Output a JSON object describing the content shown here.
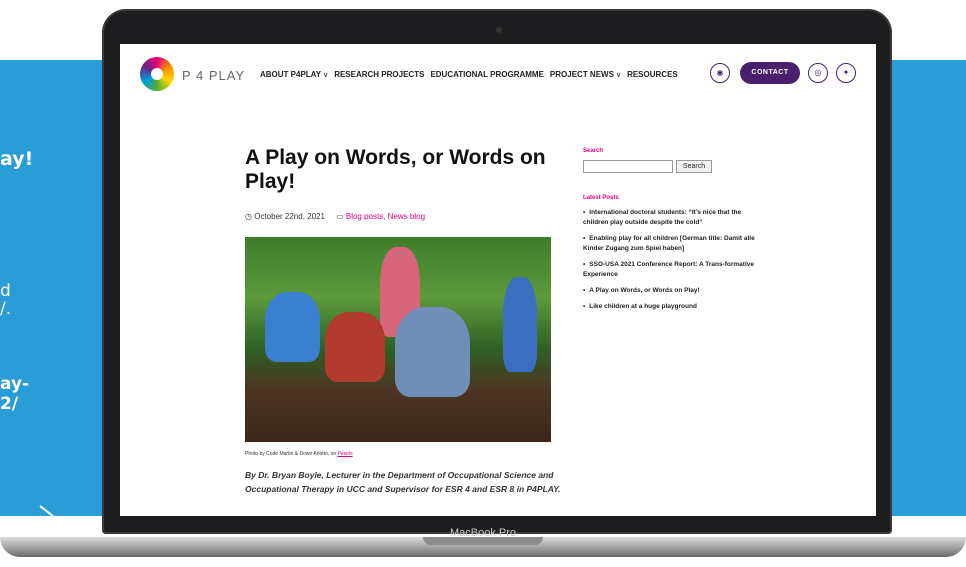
{
  "slide": {
    "line1": "ay!",
    "line2": "d",
    "line3": "/.",
    "line4": "ay-",
    "line5": "2/"
  },
  "laptop": {
    "model_label": "MacBook Pro"
  },
  "site": {
    "brand": "P 4 PLAY",
    "menu": [
      {
        "label": "ABOUT P4PLAY",
        "dropdown": true
      },
      {
        "label": "RESEARCH PROJECTS",
        "dropdown": false
      },
      {
        "label": "EDUCATIONAL PROGRAMME",
        "dropdown": false
      },
      {
        "label": "PROJECT NEWS",
        "dropdown": true
      },
      {
        "label": "RESOURCES",
        "dropdown": false
      }
    ],
    "icons": [
      "eye-icon",
      "instagram-icon",
      "twitter-icon"
    ],
    "contact_label": "CONTACT",
    "accent": "#4a1f6d",
    "link_color": "#e6007e"
  },
  "article": {
    "title": "A Play on Words, or Words on Play!",
    "date": "October 22nd, 2021",
    "categories": "Blog posts, News blog",
    "caption_prefix": "Photo by Code Martin & Down Arlotto, on ",
    "caption_link": "Pexels",
    "byline": "By Dr. Bryan Boyle, Lecturer in the Department of Occupational Science and Occupational Therapy in UCC and Supervisor for ESR 4 and ESR 8 in P4PLAY."
  },
  "sidebar": {
    "search_label": "Search",
    "search_placeholder": "",
    "search_button": "Search",
    "latest_label": "Latest Posts",
    "posts": [
      "International doctoral students: “It’s nice that the children play outside despite the cold”",
      "Enabling play for all children [German title: Damit alle Kinder Zugang zum Spiel haben]",
      "SSO-USA 2021 Conference Report: A Trans-formative Experience",
      "A Play on Words, or Words on Play!",
      "Like children at a huge playground"
    ]
  }
}
